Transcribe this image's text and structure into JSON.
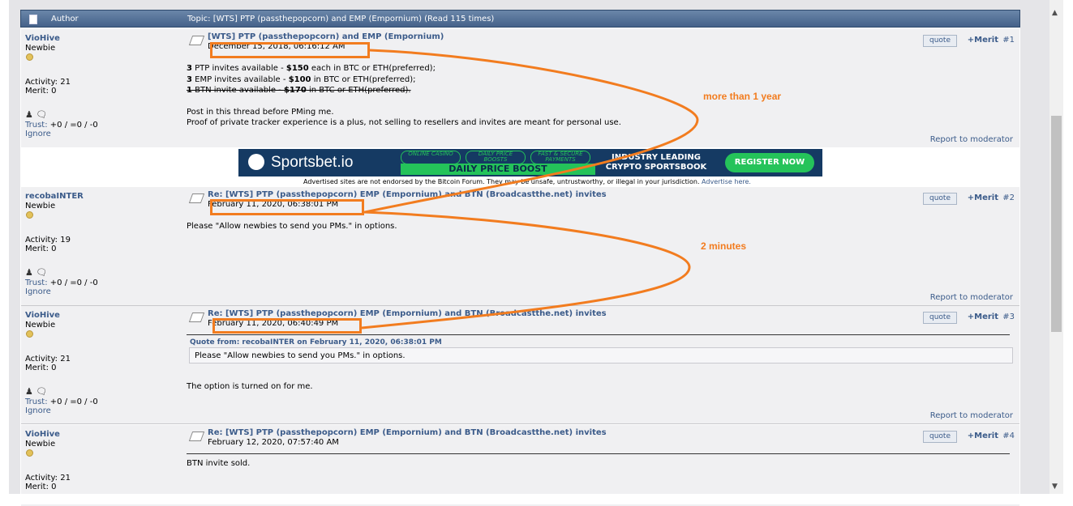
{
  "header": {
    "author_label": "Author",
    "topic_title": "Topic: [WTS] PTP (passthepopcorn) and EMP (Empornium)  (Read 115 times)"
  },
  "common": {
    "quote_label": "quote",
    "merit_label": "+Merit",
    "report_label": "Report to moderator",
    "trust_label": "Trust:",
    "trust_value": " +0 / =0 / -0",
    "ignore_label": "Ignore"
  },
  "posts": [
    {
      "author": "VioHive",
      "rank": "Newbie",
      "activity": "Activity: 21",
      "merit": "Merit: 0",
      "subject": "[WTS] PTP (passthepopcorn) and EMP (Empornium)",
      "date": "December 15, 2018, 06:16:12 AM",
      "number": "#1",
      "lines": [
        {
          "pre": "3",
          "mid": " PTP invites available - ",
          "price": "$150",
          "post": " each in BTC or ETH(preferred);"
        },
        {
          "pre": "3",
          "mid": " EMP invites available - ",
          "price": "$100",
          "post": " in BTC or ETH(preferred);"
        },
        {
          "pre": "1",
          "mid": " BTN invite available - ",
          "price": "$170",
          "post": " in BTC or ETH(preferred)."
        },
        {
          "text": "Post in this thread before PMing me."
        },
        {
          "text": "Proof of private tracker experience is a plus, not selling to resellers and invites are meant for personal use."
        }
      ]
    },
    {
      "author": "recobaINTER",
      "rank": "Newbie",
      "activity": "Activity: 19",
      "merit": "Merit: 0",
      "subject": "Re: [WTS] PTP (passthepopcorn) EMP (Empornium) and BTN (Broadcastthe.net) invites",
      "date": "February 11, 2020, 06:38:01 PM",
      "number": "#2",
      "body": "Please \"Allow newbies to send you PMs.\" in options."
    },
    {
      "author": "VioHive",
      "rank": "Newbie",
      "activity": "Activity: 21",
      "merit": "Merit: 0",
      "subject": "Re: [WTS] PTP (passthepopcorn) EMP (Empornium) and BTN (Broadcastthe.net) invites",
      "date": "February 11, 2020, 06:40:49 PM",
      "number": "#3",
      "quote_header": "Quote from: recobaINTER on February 11, 2020, 06:38:01 PM",
      "quote_text": "Please \"Allow newbies to send you PMs.\" in options.",
      "body": "The option is turned on for me."
    },
    {
      "author": "VioHive",
      "rank": "Newbie",
      "activity": "Activity: 21",
      "merit": "Merit: 0",
      "subject": "Re: [WTS] PTP (passthepopcorn) EMP (Empornium) and BTN (Broadcastthe.net) invites",
      "date": "February 12, 2020, 07:57:40 AM",
      "number": "#4",
      "body": "BTN invite sold."
    }
  ],
  "ad": {
    "brand": "Sportsbet.io",
    "pill1": "ONLINE CASINO",
    "pill2": "DAILY PRICE BOOSTS",
    "pill3": "FAST & SECURE PAYMENTS",
    "strip": "DAILY PRICE BOOST",
    "industry": "INDUSTRY LEADING CRYPTO SPORTSBOOK",
    "register": "REGISTER NOW",
    "disclaimer": "Advertised sites are not endorsed by the Bitcoin Forum. They may be unsafe, untrustworthy, or illegal in your jurisdiction.",
    "advertise_link": "Advertise here."
  },
  "annotations": {
    "gap1": "more than 1 year",
    "gap2": "2 minutes",
    "color": "#f27c1f"
  }
}
